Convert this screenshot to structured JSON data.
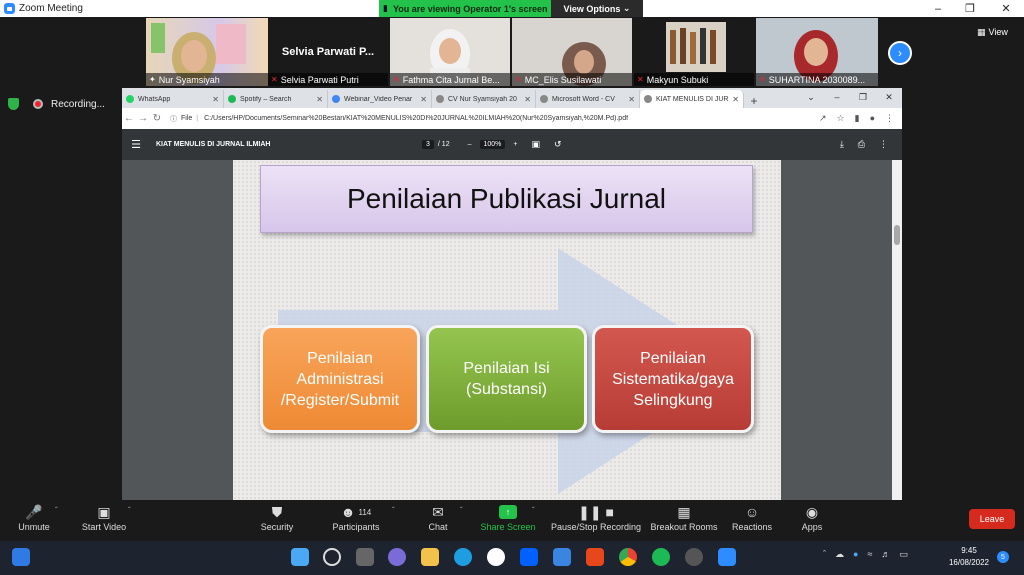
{
  "window": {
    "title": "Zoom Meeting"
  },
  "share_banner": {
    "text": "You are viewing Operator 1's screen",
    "view_options": "View Options"
  },
  "view_button": "View",
  "participants": [
    {
      "name": "Nur Syamsiyah"
    },
    {
      "name": "Selvia Parwati Putri",
      "card_name": "Selvia Parwati P..."
    },
    {
      "name": "Fathma Cita Jurnal Be..."
    },
    {
      "name": "MC_Elis Susilawati"
    },
    {
      "name": "Makyun Subuki"
    },
    {
      "name": "SUHARTINA 2030089..."
    }
  ],
  "recording": {
    "label": "Recording..."
  },
  "browser": {
    "tabs": [
      {
        "label": "WhatsApp",
        "color": "#25d366"
      },
      {
        "label": "Spotify – Search",
        "color": "#1db954"
      },
      {
        "label": "Webinar_Video Penar",
        "color": "#4285f4"
      },
      {
        "label": "CV Nur Syamsiyah 20",
        "color": "#888888"
      },
      {
        "label": "Microsoft Word - CV",
        "color": "#888888"
      },
      {
        "label": "KIAT MENULIS DI JUR",
        "color": "#888888"
      }
    ],
    "address_prefix": "File",
    "url": "C:/Users/HP/Documents/Seminar%20Bestari/KIAT%20MENULIS%20DI%20JURNAL%20ILMIAH%20(Nur%20Syamsiyah,%20M.Pd).pdf"
  },
  "pdf": {
    "title": "KIAT MENULIS DI JURNAL ILMIAH",
    "page_current": "3",
    "page_total": "/ 12",
    "zoom": "100%"
  },
  "slide": {
    "title": "Penilaian Publikasi Jurnal",
    "boxes": [
      "Penilaian Administrasi /Register/Submit",
      "Penilaian Isi (Substansi)",
      "Penilaian Sistematika/gaya Selingkung"
    ]
  },
  "controls": {
    "unmute": "Unmute",
    "start_video": "Start Video",
    "security": "Security",
    "participants": "Participants",
    "participant_count": "114",
    "chat": "Chat",
    "share_screen": "Share Screen",
    "pause_stop": "Pause/Stop Recording",
    "breakout": "Breakout Rooms",
    "reactions": "Reactions",
    "apps": "Apps",
    "leave": "Leave"
  },
  "taskbar": {
    "time": "9:45",
    "date": "16/08/2022"
  }
}
